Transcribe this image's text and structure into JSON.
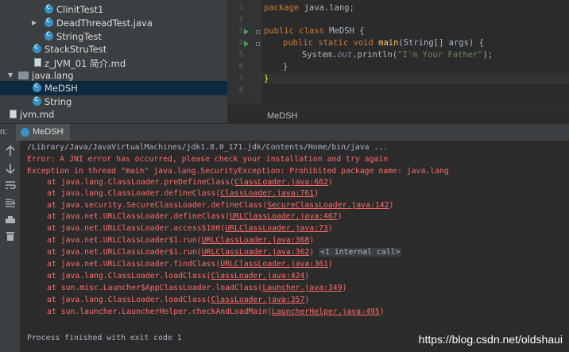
{
  "tree": {
    "items": [
      {
        "label": "ClinitTest1",
        "icon": "class-icon"
      },
      {
        "label": "DeadThreadTest.java",
        "icon": "class-icon",
        "arrow": "▶"
      },
      {
        "label": "StringTest",
        "icon": "class-icon"
      },
      {
        "label": "StackStruTest",
        "icon": "class-icon"
      },
      {
        "label": "z_JVM_01 简介.md",
        "icon": "markdown-file-icon"
      },
      {
        "label": "java.lang",
        "icon": "package-folder-icon",
        "arrow": "▼"
      },
      {
        "label": "MeDSH",
        "icon": "class-icon",
        "selected": true
      },
      {
        "label": "String",
        "icon": "class-icon"
      },
      {
        "label": "jvm.md",
        "icon": "markdown-file-icon"
      }
    ]
  },
  "editor": {
    "line_numbers": [
      "1",
      "2",
      "3",
      "4",
      "5",
      "6",
      "7",
      "8"
    ],
    "code": {
      "l1_kw": "package",
      "l1_rest": " java.lang;",
      "l3_kw": "public class",
      "l3_rest": " MeDSH {",
      "l4_kw": "public static void",
      "l4_fn": "main",
      "l4_rest": "(String[] args) {",
      "l5_a": "System.",
      "l5_out": "out",
      "l5_b": ".println(",
      "l5_str": "\"I'm Your Father\"",
      "l5_c": ");",
      "l6": "}",
      "l7": "}"
    },
    "breadcrumb": "MeDSH"
  },
  "run_panel": {
    "label": "n:",
    "tab": "MeDSH",
    "tab_close": "×",
    "tools": [
      "up-arrow-icon",
      "down-arrow-icon",
      "soft-wrap-icon",
      "scroll-to-end-icon",
      "print-icon",
      "trash-icon"
    ]
  },
  "console": {
    "cmd": "/Library/Java/JavaVirtualMachines/jdk1.8.0_171.jdk/Contents/Home/bin/java ...",
    "err1": "Error: A JNI error has occurred, please check your installation and try again",
    "err2": "Exception in thread \"main\" java.lang.SecurityException: Prohibited package name: java.lang",
    "stack": [
      {
        "pre": "at java.lang.ClassLoader.preDefineClass(",
        "link": "ClassLoader.java:662",
        "post": ")"
      },
      {
        "pre": "at java.lang.ClassLoader.defineClass(",
        "link": "ClassLoader.java:761",
        "post": ")"
      },
      {
        "pre": "at java.security.SecureClassLoader.defineClass(",
        "link": "SecureClassLoader.java:142",
        "post": ")"
      },
      {
        "pre": "at java.net.URLClassLoader.defineClass(",
        "link": "URLClassLoader.java:467",
        "post": ")"
      },
      {
        "pre": "at java.net.URLClassLoader.access$100(",
        "link": "URLClassLoader.java:73",
        "post": ")"
      },
      {
        "pre": "at java.net.URLClassLoader$1.run(",
        "link": "URLClassLoader.java:368",
        "post": ")"
      },
      {
        "pre": "at java.net.URLClassLoader$1.run(",
        "link": "URLClassLoader.java:362",
        "post": ")",
        "fold": "<1 internal call>"
      },
      {
        "pre": "at java.net.URLClassLoader.findClass(",
        "link": "URLClassLoader.java:361",
        "post": ")"
      },
      {
        "pre": "at java.lang.ClassLoader.loadClass(",
        "link": "ClassLoader.java:424",
        "post": ")"
      },
      {
        "pre": "at sun.misc.Launcher$AppClassLoader.loadClass(",
        "link": "Launcher.java:349",
        "post": ")"
      },
      {
        "pre": "at java.lang.ClassLoader.loadClass(",
        "link": "ClassLoader.java:357",
        "post": ")"
      },
      {
        "pre": "at sun.launcher.LauncherHelper.checkAndLoadMain(",
        "link": "LauncherHelper.java:495",
        "post": ")"
      }
    ],
    "exit": "Process finished with exit code 1",
    "watermark": "https://blog.csdn.net/oldshaui"
  }
}
